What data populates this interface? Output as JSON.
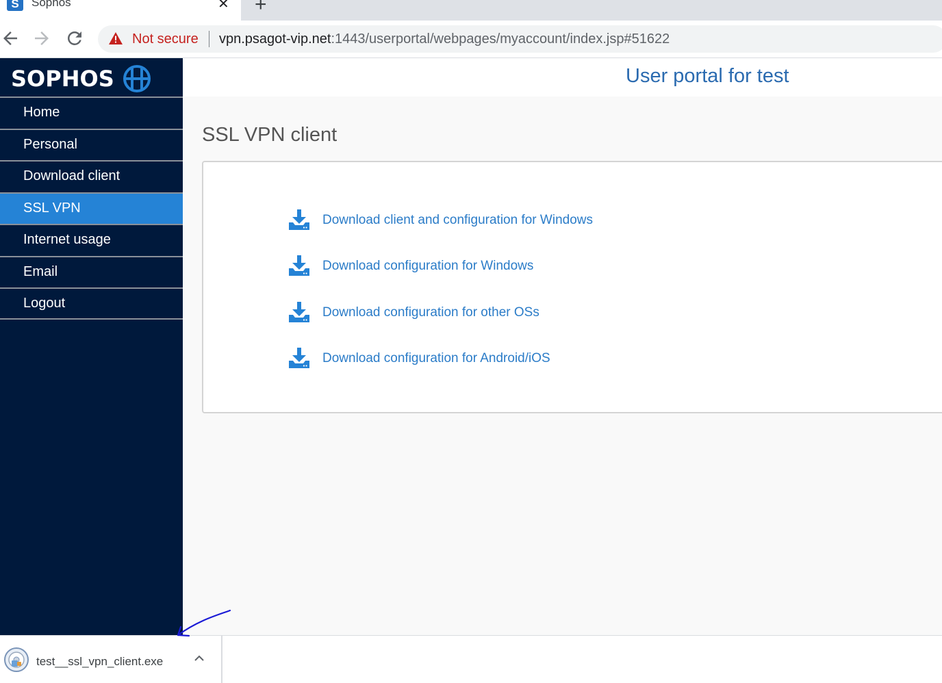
{
  "browser": {
    "tab_title": "Sophos",
    "favicon_letter": "S",
    "close_glyph": "✕",
    "new_tab_glyph": "+",
    "security_label": "Not secure",
    "url_host": "vpn.psagot-vip.net",
    "url_rest": ":1443/userportal/webpages/myaccount/index.jsp#51622"
  },
  "sidebar": {
    "logo_text": "SOPHOS",
    "items": [
      {
        "label": "Home",
        "active": false
      },
      {
        "label": "Personal",
        "active": false
      },
      {
        "label": "Download client",
        "active": false
      },
      {
        "label": "SSL VPN",
        "active": true
      },
      {
        "label": "Internet usage",
        "active": false
      },
      {
        "label": "Email",
        "active": false
      },
      {
        "label": "Logout",
        "active": false
      }
    ]
  },
  "header": {
    "title": "User portal for test"
  },
  "main": {
    "section_title": "SSL VPN client",
    "links": [
      {
        "label": "Download client and configuration for Windows"
      },
      {
        "label": "Download configuration for Windows"
      },
      {
        "label": "Download configuration for other OSs"
      },
      {
        "label": "Download configuration for Android/iOS"
      }
    ]
  },
  "download_shelf": {
    "file_name": "test__ssl_vpn_client.exe"
  },
  "colors": {
    "sidebar_bg": "#00193c",
    "active_item": "#2583d6",
    "link": "#2b7cc8",
    "title": "#2b6bb0",
    "warning": "#c5221f"
  }
}
